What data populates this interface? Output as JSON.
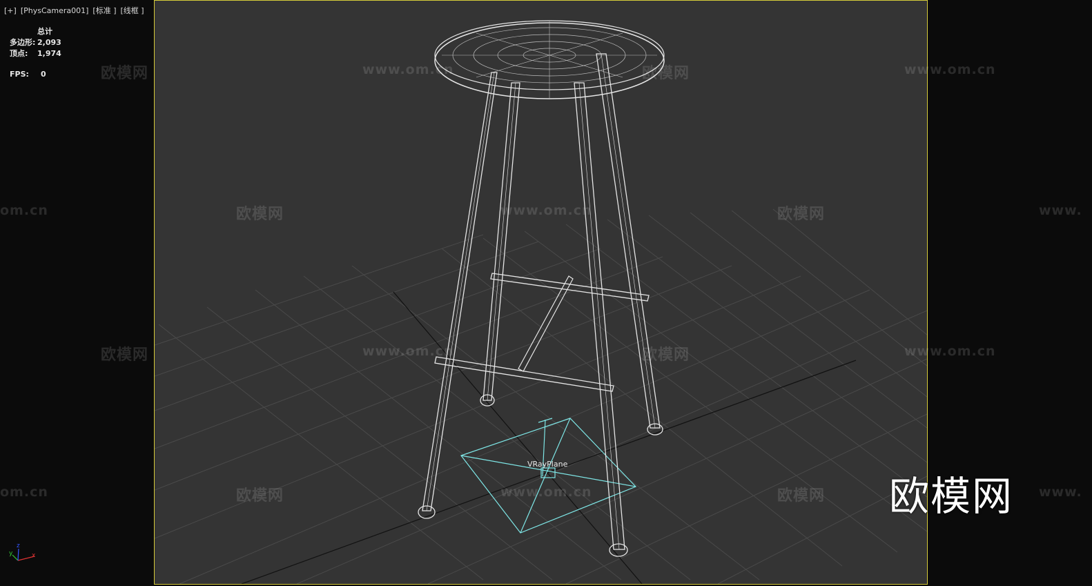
{
  "viewport": {
    "label_parts": [
      "[+]",
      "[PhysCamera001]",
      "[标准 ]",
      "[线框 ]"
    ]
  },
  "stats": {
    "header": "总计",
    "polygons_label": "多边形:",
    "polygons_value": "2,093",
    "vertices_label": "顶点:",
    "vertices_value": "1,974",
    "fps_label": "FPS:",
    "fps_value": "0"
  },
  "scene": {
    "object_label": "VRayPlane",
    "wireframe_color": "#e6e6e6",
    "plane_color": "#7ee6e6",
    "frame_color": "#d6cc3a"
  },
  "axis": {
    "x": "x",
    "y": "y",
    "z": "z"
  },
  "watermark": {
    "logo": "欧模网",
    "url": "www.om.cn",
    "url_cut": "om.cn",
    "url_left": "www."
  }
}
